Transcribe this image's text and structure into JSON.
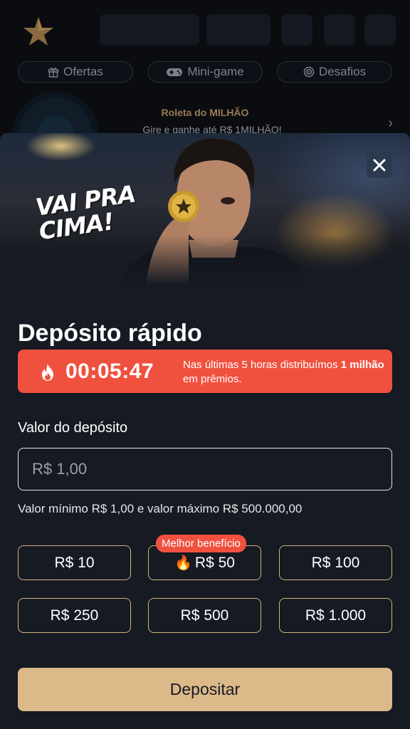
{
  "nav": {
    "pills": [
      {
        "icon": "gift-icon",
        "label": "Ofertas"
      },
      {
        "icon": "gamepad-icon",
        "label": "Mini-game"
      },
      {
        "icon": "target-icon",
        "label": "Desafios"
      }
    ]
  },
  "promo": {
    "title": "Roleta do MILHÃO",
    "subtitle": "Gire e ganhe até R$ 1MILHÃO!"
  },
  "modal": {
    "hero_text_line1": "VAI PRA",
    "hero_text_line2": "CIMA!",
    "title": "Depósito rápido",
    "timer": {
      "countdown": "00:05:47",
      "msg_prefix": "Nas últimas 5 horas distribuímos",
      "msg_bold": "1 milhão",
      "msg_suffix": "em prêmios."
    },
    "deposit_label": "Valor do depósito",
    "input_placeholder": "R$ 1,00",
    "hint": "Valor mínimo R$ 1,00 e valor máximo R$ 500.000,00",
    "badge": "Melhor benefício",
    "presets": [
      "R$ 10",
      "R$ 50",
      "R$ 100",
      "R$ 250",
      "R$ 500",
      "R$ 1.000"
    ],
    "highlighted_preset": "R$ 50",
    "submit_label": "Depositar"
  },
  "colors": {
    "accent_gold": "#dcb988",
    "timer_red": "#f0513f",
    "sheet_bg": "#151a23"
  }
}
